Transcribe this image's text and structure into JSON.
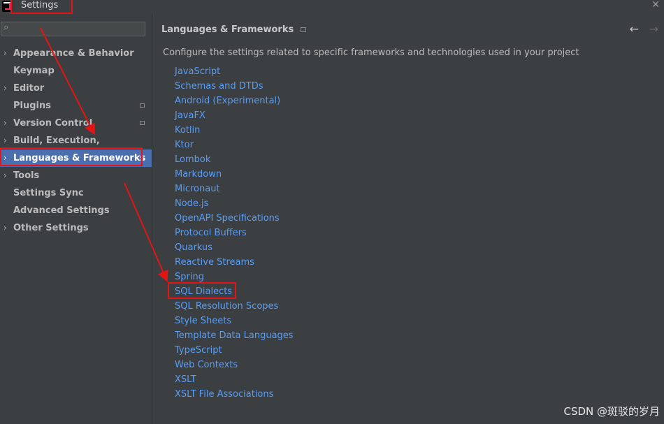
{
  "window": {
    "title": "Settings",
    "close_glyph": "✕",
    "logo": "intellij-logo"
  },
  "search": {
    "glyph": "⌕",
    "placeholder": ""
  },
  "sidebar": {
    "items": [
      {
        "label": "Appearance & Behavior",
        "expandable": true,
        "badge": false
      },
      {
        "label": "Keymap",
        "expandable": false,
        "badge": false
      },
      {
        "label": "Editor",
        "expandable": true,
        "badge": false
      },
      {
        "label": "Plugins",
        "expandable": false,
        "badge": true
      },
      {
        "label": "Version Control",
        "expandable": true,
        "badge": true
      },
      {
        "label": "Build, Execution, Deployment",
        "expandable": true,
        "badge": false
      },
      {
        "label": "Languages & Frameworks",
        "expandable": true,
        "badge": false,
        "selected": true
      },
      {
        "label": "Tools",
        "expandable": true,
        "badge": false
      },
      {
        "label": "Settings Sync",
        "expandable": false,
        "badge": false
      },
      {
        "label": "Advanced Settings",
        "expandable": false,
        "badge": false
      },
      {
        "label": "Other Settings",
        "expandable": true,
        "badge": false
      }
    ]
  },
  "content": {
    "title": "Languages & Frameworks",
    "back_glyph": "←",
    "forward_glyph": "→",
    "description": "Configure the settings related to specific frameworks and technologies used in your project",
    "links": [
      "JavaScript",
      "Schemas and DTDs",
      "Android (Experimental)",
      "JavaFX",
      "Kotlin",
      "Ktor",
      "Lombok",
      "Markdown",
      "Micronaut",
      "Node.js",
      "OpenAPI Specifications",
      "Protocol Buffers",
      "Quarkus",
      "Reactive Streams",
      "Spring",
      "SQL Dialects",
      "SQL Resolution Scopes",
      "Style Sheets",
      "Template Data Languages",
      "TypeScript",
      "Web Contexts",
      "XSLT",
      "XSLT File Associations"
    ]
  },
  "watermark": "CSDN @斑驳的岁月",
  "colors": {
    "background": "#3c3f41",
    "selection": "#4b6eaf",
    "link": "#589df6",
    "annotation": "#e51414"
  }
}
